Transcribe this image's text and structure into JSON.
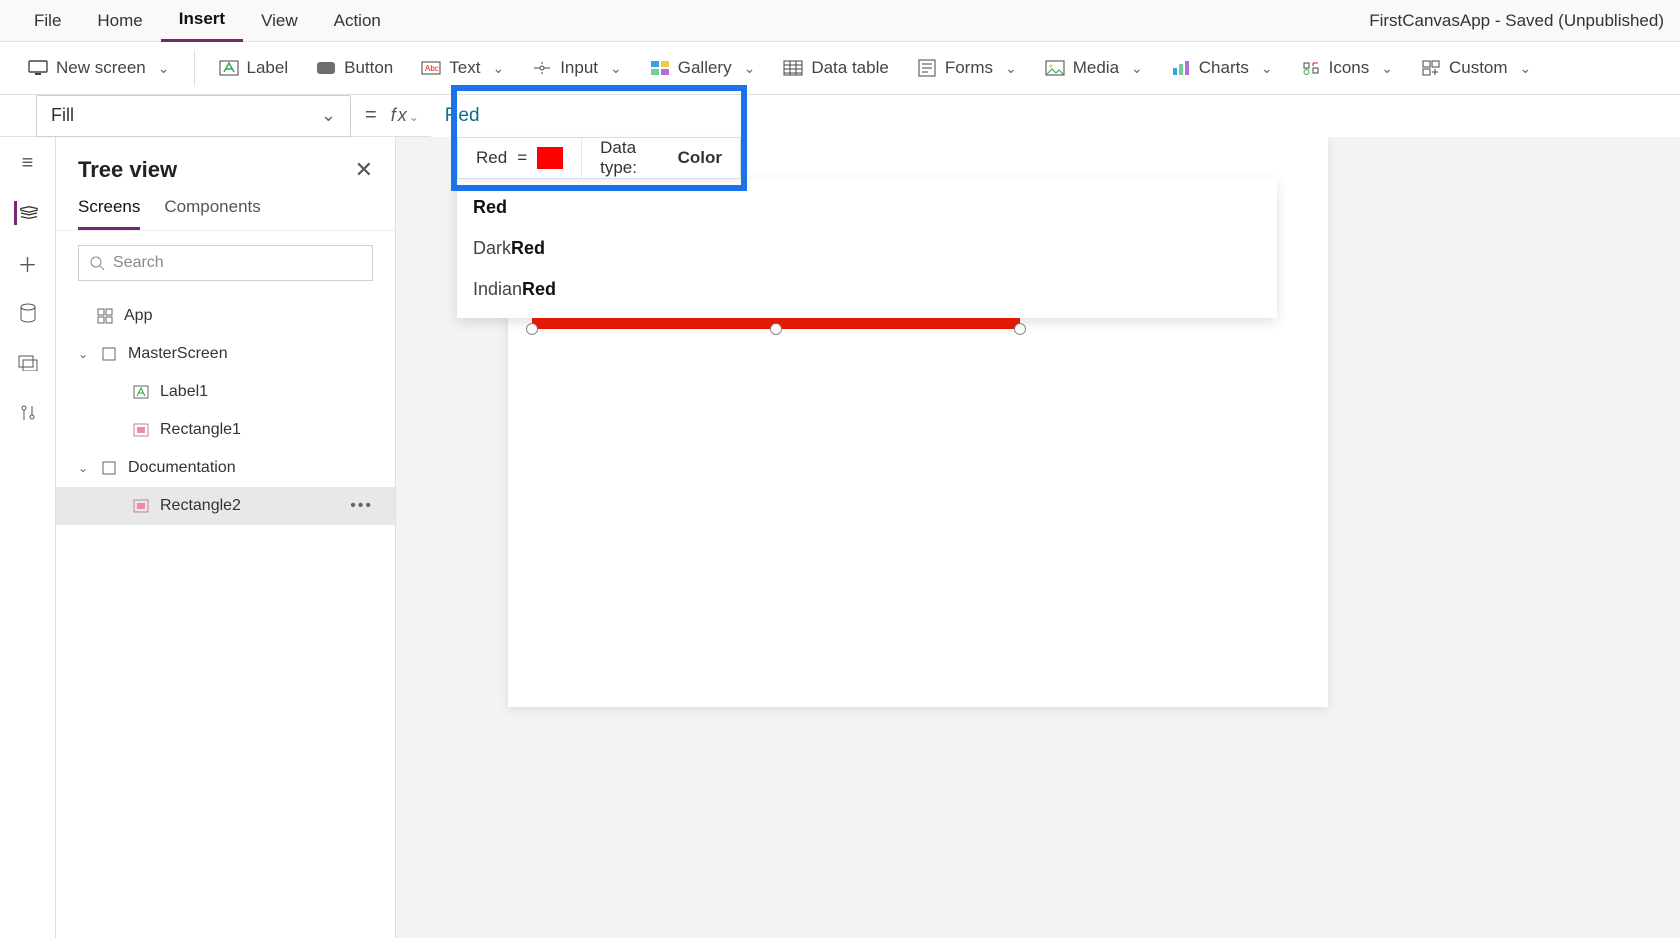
{
  "menu": {
    "file": "File",
    "home": "Home",
    "insert": "Insert",
    "view": "View",
    "action": "Action"
  },
  "app_title": "FirstCanvasApp - Saved (Unpublished)",
  "ribbon": {
    "new_screen": "New screen",
    "label": "Label",
    "button": "Button",
    "text": "Text",
    "input": "Input",
    "gallery": "Gallery",
    "data_table": "Data table",
    "forms": "Forms",
    "media": "Media",
    "charts": "Charts",
    "icons": "Icons",
    "custom": "Custom"
  },
  "property": {
    "name": "Fill"
  },
  "formula": {
    "value": "Red"
  },
  "eval": {
    "name": "Red",
    "eq": "=",
    "swatch_color": "#ff0000",
    "data_type_label": "Data type:",
    "data_type": "Color"
  },
  "autocomplete": [
    {
      "prefix": "",
      "match": "Red"
    },
    {
      "prefix": "Dark",
      "match": "Red"
    },
    {
      "prefix": "Indian",
      "match": "Red"
    }
  ],
  "leftpanel": {
    "title": "Tree view",
    "tabs": {
      "screens": "Screens",
      "components": "Components"
    },
    "search_placeholder": "Search",
    "nodes": {
      "app": "App",
      "master": "MasterScreen",
      "label1": "Label1",
      "rect1": "Rectangle1",
      "doc": "Documentation",
      "rect2": "Rectangle2"
    }
  }
}
